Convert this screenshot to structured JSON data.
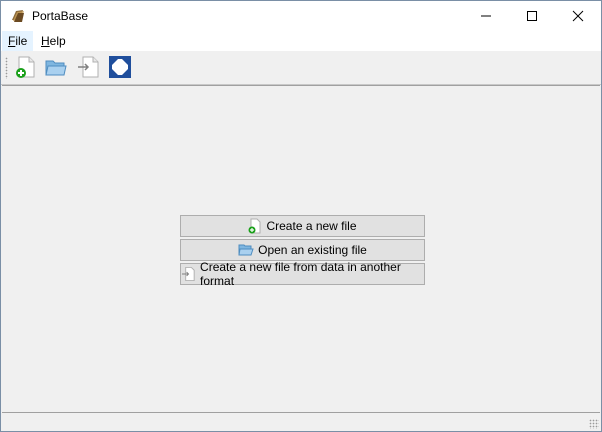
{
  "window": {
    "title": "PortaBase"
  },
  "icons": {
    "app": "portabase-app-icon",
    "minimize": "minimize-icon",
    "maximize": "maximize-icon",
    "close": "close-icon",
    "new_file": "new-file-icon",
    "open_folder": "folder-open-icon",
    "import": "import-file-icon",
    "fullscreen": "fullscreen-icon"
  },
  "menu": {
    "items": [
      {
        "label": "File",
        "mnemonic": "F",
        "rest": "ile"
      },
      {
        "label": "Help",
        "mnemonic": "H",
        "rest": "elp"
      }
    ]
  },
  "main": {
    "buttons": [
      {
        "label": "Create a new file"
      },
      {
        "label": "Open an existing file"
      },
      {
        "label": "Create a new file from data in another format"
      }
    ]
  },
  "colors": {
    "accent_green": "#1aa01a",
    "folder_blue": "#5a9fd4",
    "fullscreen_blue": "#1f4e9c",
    "menu_active": "#e5f3ff"
  }
}
